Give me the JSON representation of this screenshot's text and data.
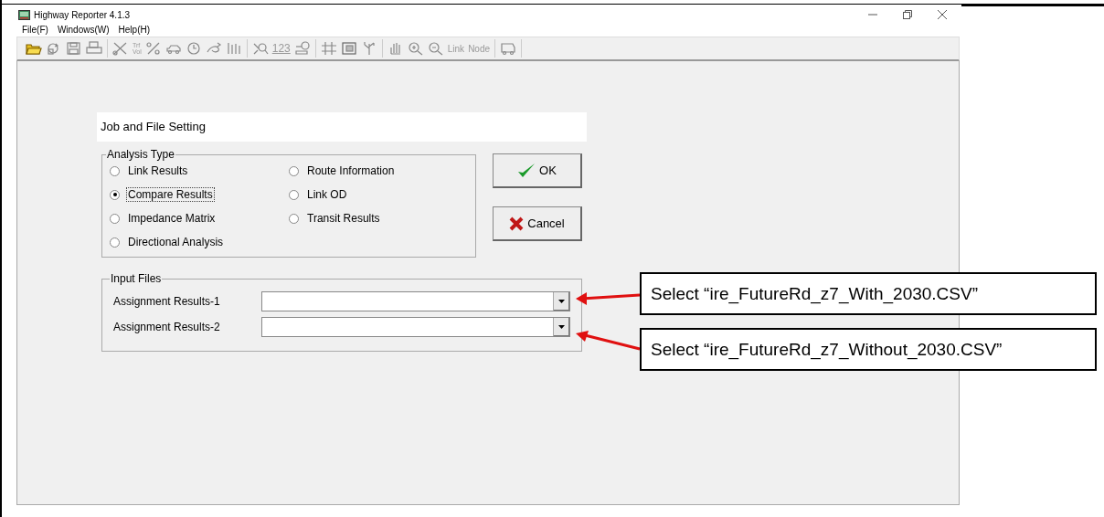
{
  "window": {
    "title": "Highway Reporter 4.1.3"
  },
  "menu": [
    {
      "label": "File(F)"
    },
    {
      "label": "Windows(W)"
    },
    {
      "label": "Help(H)"
    }
  ],
  "toolbar": {
    "groups": [
      [
        {
          "kind": "icon"
        },
        {
          "kind": "icon"
        },
        {
          "kind": "icon"
        },
        {
          "kind": "icon"
        }
      ],
      [
        {
          "kind": "icon"
        },
        {
          "kind": "stacked",
          "lines": [
            "Trf",
            "Vol"
          ]
        },
        {
          "kind": "icon"
        },
        {
          "kind": "icon"
        },
        {
          "kind": "icon"
        },
        {
          "kind": "icon"
        },
        {
          "kind": "icon"
        }
      ],
      [
        {
          "kind": "icon"
        },
        {
          "kind": "text",
          "label": "123"
        },
        {
          "kind": "icon"
        }
      ],
      [
        {
          "kind": "icon"
        },
        {
          "kind": "icon"
        },
        {
          "kind": "icon"
        }
      ],
      [
        {
          "kind": "icon"
        },
        {
          "kind": "icon"
        },
        {
          "kind": "icon"
        },
        {
          "kind": "text",
          "label": "Link"
        },
        {
          "kind": "text",
          "label": "Node"
        }
      ],
      [
        {
          "kind": "icon"
        }
      ]
    ]
  },
  "dialog": {
    "title": "Job and File Setting",
    "analysis_type": {
      "legend": "Analysis Type",
      "columns": [
        [
          {
            "label": "Link Results",
            "selected": false
          },
          {
            "label": "Compare Results",
            "selected": true
          },
          {
            "label": "Impedance Matrix",
            "selected": false
          },
          {
            "label": "Directional Analysis",
            "selected": false
          }
        ],
        [
          {
            "label": "Route Information",
            "selected": false
          },
          {
            "label": "Link OD",
            "selected": false
          },
          {
            "label": "Transit Results",
            "selected": false
          }
        ]
      ]
    },
    "buttons": [
      {
        "kind": "ok",
        "label": "OK"
      },
      {
        "kind": "cancel",
        "label": "Cancel"
      }
    ],
    "input_files": {
      "legend": "Input Files",
      "fields": [
        {
          "label": "Assignment Results-1"
        },
        {
          "label": "Assignment Results-2"
        }
      ]
    }
  },
  "callouts": [
    {
      "text": "Select “ire_FutureRd_z7_With_2030.CSV”"
    },
    {
      "text": "Select “ire_FutureRd_z7_Without_2030.CSV”"
    }
  ]
}
